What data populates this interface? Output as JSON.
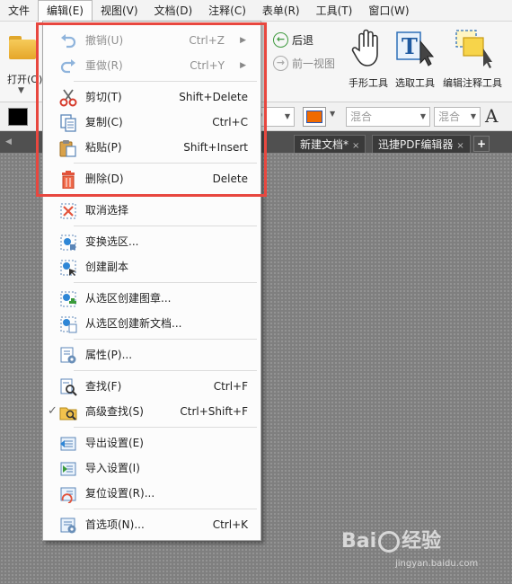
{
  "menubar": [
    "文件",
    "编辑(E)",
    "视图(V)",
    "文档(D)",
    "注释(C)",
    "表单(R)",
    "工具(T)",
    "窗口(W)"
  ],
  "ribbon": {
    "open_label": "打开(O)",
    "back_label": "后退",
    "prev_view_label": "前一视图",
    "hand_tool": "手形工具",
    "select_tool": "选取工具",
    "edit_annot_tool": "编辑注释工具",
    "blend_1": "混合",
    "blend_2": "混合",
    "font_size_label": "A"
  },
  "tabs": [
    {
      "label": "新建文档",
      "mark": "*"
    },
    {
      "label": "迅捷PDF编辑器",
      "mark": ""
    }
  ],
  "tab_add": "+",
  "menu": {
    "items": [
      {
        "label": "撤销(U)",
        "shortcut": "Ctrl+Z",
        "disabled": true,
        "submenu": true
      },
      {
        "label": "重做(R)",
        "shortcut": "Ctrl+Y",
        "disabled": true,
        "submenu": true
      },
      {
        "label": "剪切(T)",
        "shortcut": "Shift+Delete"
      },
      {
        "label": "复制(C)",
        "shortcut": "Ctrl+C"
      },
      {
        "label": "粘贴(P)",
        "shortcut": "Shift+Insert"
      },
      {
        "label": "删除(D)",
        "shortcut": "Delete"
      },
      {
        "label": "取消选择",
        "shortcut": ""
      },
      {
        "label": "变换选区...",
        "shortcut": ""
      },
      {
        "label": "创建副本",
        "shortcut": ""
      },
      {
        "label": "从选区创建图章...",
        "shortcut": ""
      },
      {
        "label": "从选区创建新文档...",
        "shortcut": ""
      },
      {
        "label": "属性(P)...",
        "shortcut": ""
      },
      {
        "label": "查找(F)",
        "shortcut": "Ctrl+F"
      },
      {
        "label": "高级查找(S)",
        "shortcut": "Ctrl+Shift+F",
        "checked": true
      },
      {
        "label": "导出设置(E)",
        "shortcut": ""
      },
      {
        "label": "导入设置(I)",
        "shortcut": ""
      },
      {
        "label": "复位设置(R)...",
        "shortcut": ""
      },
      {
        "label": "首选项(N)...",
        "shortcut": "Ctrl+K"
      }
    ],
    "check_glyph": "✓",
    "submenu_glyph": "▶"
  },
  "watermark": {
    "brand": "Bai",
    "suffix": "经验",
    "url": "jingyan.baidu.com"
  },
  "colors": {
    "highlight": "#e8473f",
    "accent_orange": "#f06a00",
    "green": "#3f9a3f"
  }
}
